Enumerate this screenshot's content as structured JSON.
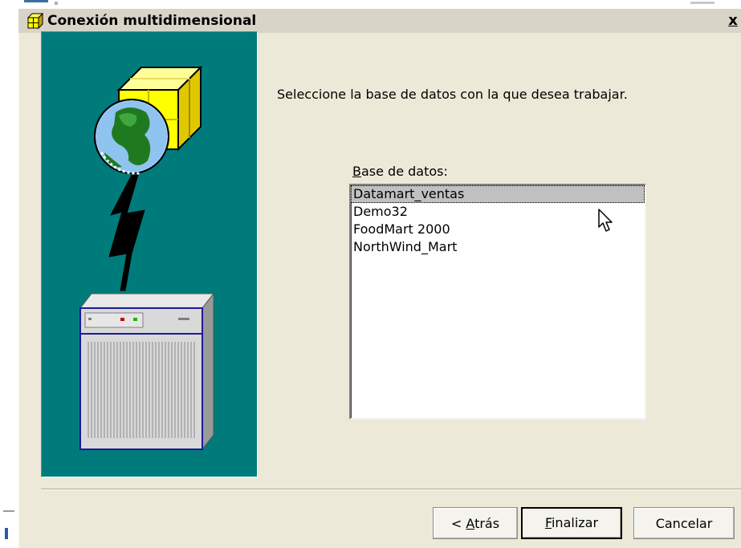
{
  "window": {
    "title": "Conexión multidimensional",
    "close_glyph": "x"
  },
  "illustration": {
    "icons": [
      "cube-icon",
      "globe-icon",
      "lightning-icon",
      "server-icon"
    ],
    "background_color": "#007b7b"
  },
  "main": {
    "instruction": "Seleccione la base de datos con la que desea trabajar.",
    "list_label_accel": "B",
    "list_label_rest": "ase de datos:",
    "databases": [
      {
        "label": "Datamart_ventas",
        "selected": true
      },
      {
        "label": "Demo32",
        "selected": false
      },
      {
        "label": "FoodMart 2000",
        "selected": false
      },
      {
        "label": "NorthWind_Mart",
        "selected": false
      }
    ]
  },
  "buttons": {
    "back_prefix": "< ",
    "back_accel": "A",
    "back_rest": "trás",
    "finish_accel": "F",
    "finish_rest": "inalizar",
    "cancel": "Cancelar"
  },
  "colors": {
    "dialog_bg": "#ece9d8",
    "selection_bg": "#c0c0c0",
    "accent_teal": "#007b7b"
  }
}
